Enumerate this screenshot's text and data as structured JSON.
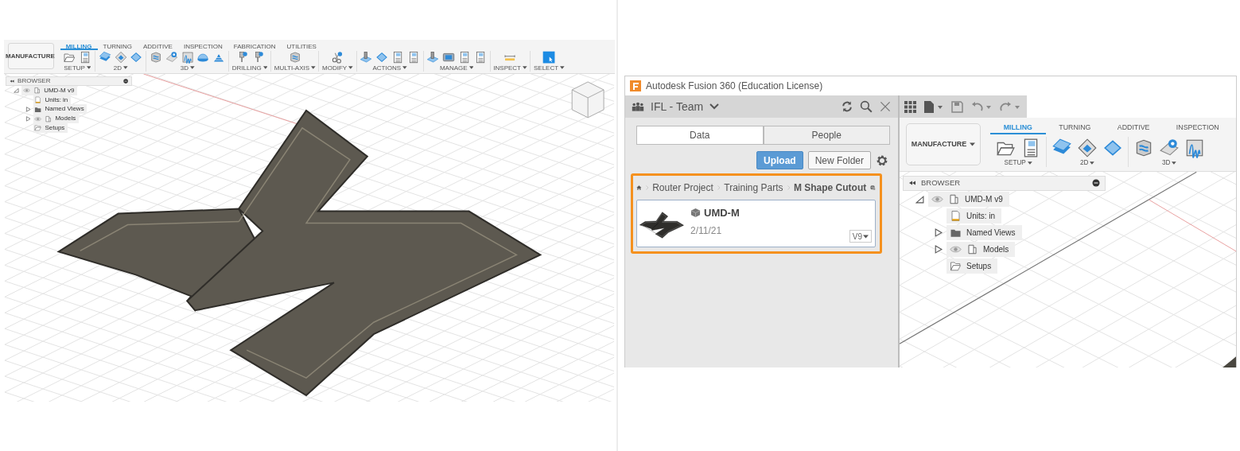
{
  "left_screenshot": {
    "toolbar": {
      "workspace": "MANUFACTURE",
      "tabs": [
        {
          "label": "MILLING",
          "selected": true
        },
        {
          "label": "TURNING",
          "selected": false
        },
        {
          "label": "ADDITIVE",
          "selected": false
        },
        {
          "label": "INSPECTION",
          "selected": false
        },
        {
          "label": "FABRICATION",
          "selected": false
        },
        {
          "label": "UTILITIES",
          "selected": false
        }
      ],
      "groups": [
        {
          "label": "SETUP"
        },
        {
          "label": "2D"
        },
        {
          "label": "3D"
        },
        {
          "label": "DRILLING"
        },
        {
          "label": "MULTI-AXIS"
        },
        {
          "label": "MODIFY"
        },
        {
          "label": "ACTIONS"
        },
        {
          "label": "MANAGE"
        },
        {
          "label": "INSPECT"
        },
        {
          "label": "SELECT"
        }
      ]
    },
    "browser": {
      "title": "BROWSER",
      "tree": [
        {
          "label": "UMD-M v9",
          "kind": "component",
          "expanded": true,
          "children": [
            {
              "label": "Units: in",
              "kind": "units"
            },
            {
              "label": "Named Views",
              "kind": "folder",
              "expanded": false
            },
            {
              "label": "Models",
              "kind": "component",
              "expanded": false
            },
            {
              "label": "Setups",
              "kind": "setups"
            }
          ]
        }
      ]
    }
  },
  "right_screenshot": {
    "window": {
      "title": "Autodesk Fusion 360 (Education License)"
    },
    "data_panel": {
      "team": "IFL - Team",
      "tabs": [
        {
          "label": "Data",
          "selected": true
        },
        {
          "label": "People",
          "selected": false
        }
      ],
      "buttons": [
        "Upload",
        "New Folder"
      ],
      "breadcrumb": [
        {
          "label": "Router Project",
          "current": false
        },
        {
          "label": "Training Parts",
          "current": false
        },
        {
          "label": "M Shape Cutout",
          "current": true
        }
      ],
      "files": [
        {
          "name": "UMD-M",
          "date": "2/11/21",
          "version": "V9"
        }
      ]
    },
    "toolbar": {
      "workspace": "MANUFACTURE",
      "tabs": [
        {
          "label": "MILLING",
          "selected": true
        },
        {
          "label": "TURNING",
          "selected": false
        },
        {
          "label": "ADDITIVE",
          "selected": false
        },
        {
          "label": "INSPECTION",
          "selected": false
        }
      ],
      "groups": [
        {
          "label": "SETUP"
        },
        {
          "label": "2D"
        },
        {
          "label": "3D"
        }
      ]
    },
    "browser": {
      "title": "BROWSER",
      "tree": [
        {
          "label": "UMD-M v9",
          "kind": "component",
          "expanded": true,
          "children": [
            {
              "label": "Units: in",
              "kind": "units"
            },
            {
              "label": "Named Views",
              "kind": "folder",
              "expanded": false
            },
            {
              "label": "Models",
              "kind": "component",
              "expanded": false
            },
            {
              "label": "Setups",
              "kind": "setups"
            }
          ]
        }
      ]
    }
  }
}
